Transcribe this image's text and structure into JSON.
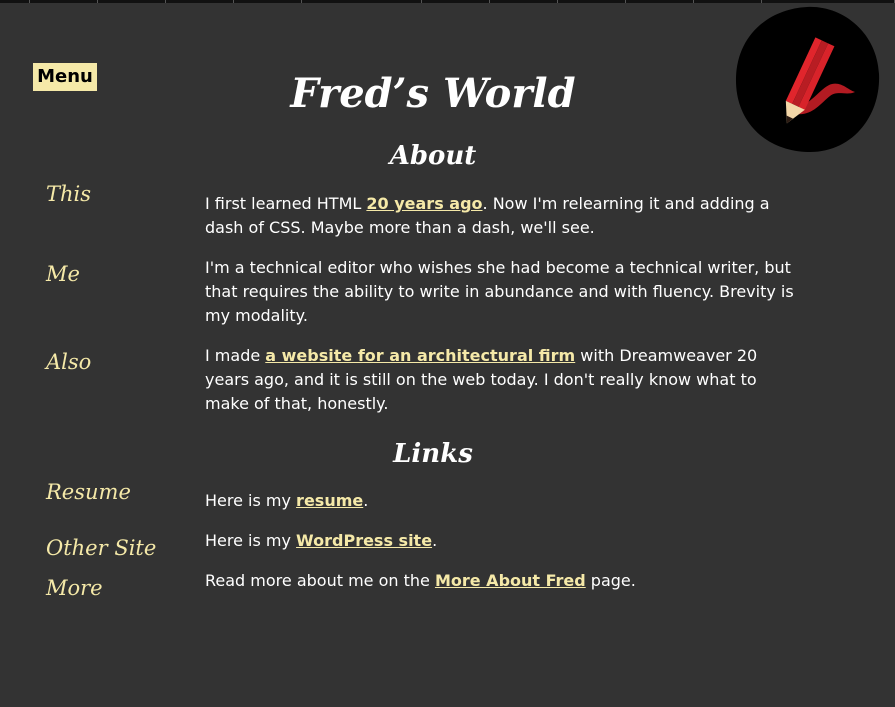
{
  "site": {
    "title": "Fred’s World",
    "menu_label": "Menu",
    "logo_icon": "pencil-logo-icon"
  },
  "colors": {
    "background": "#333333",
    "accent": "#f5e9a8",
    "text": "#ffffff",
    "pencil": "#d8232a"
  },
  "about": {
    "heading": "About",
    "items": [
      {
        "label": "This",
        "before": "I first learned HTML ",
        "link": "20 years ago",
        "after": ". Now I'm relearning it and adding a dash of CSS. Maybe more than a dash, we'll see."
      },
      {
        "label": "Me",
        "text": "I'm a technical editor who wishes she had become a technical writer, but that requires the ability to write in abundance and with fluency. Brevity is my modality."
      },
      {
        "label": "Also",
        "before": "I made ",
        "link": "a website for an architectural firm",
        "after": " with Dreamweaver 20 years ago, and it is still on the web today. I don't really know what to make of that, honestly."
      }
    ]
  },
  "links": {
    "heading": "Links",
    "items": [
      {
        "label": "Resume",
        "before": "Here is my ",
        "link": "resume",
        "after": "."
      },
      {
        "label": "Other Site",
        "before": "Here is my ",
        "link": "WordPress site",
        "after": "."
      },
      {
        "label": "More",
        "before": "Read more about me on the ",
        "link": "More About Fred",
        "after": " page."
      }
    ]
  }
}
